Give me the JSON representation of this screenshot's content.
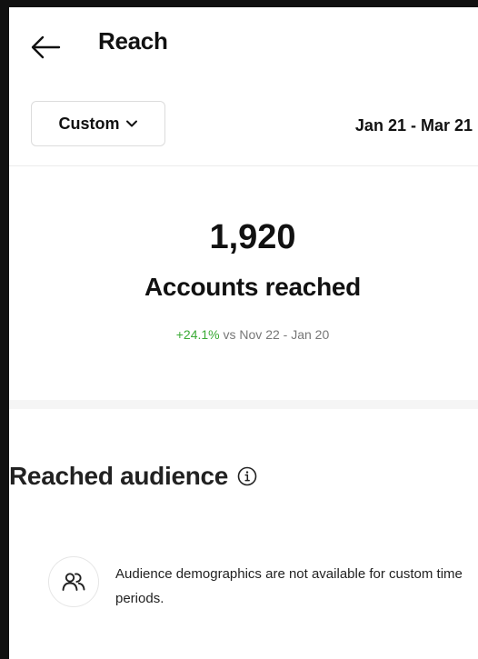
{
  "header": {
    "title": "Reach",
    "back_icon": "arrow-left-icon"
  },
  "filter": {
    "selected": "Custom",
    "chevron_icon": "chevron-down-icon",
    "date_range": "Jan 21 - Mar 21"
  },
  "summary": {
    "value": "1,920",
    "label": "Accounts reached",
    "change": "+24.1%",
    "comparison": "vs Nov 22 - Jan 20",
    "change_color": "#3aaa35"
  },
  "audience": {
    "title": "Reached audience",
    "info_icon": "info-icon",
    "notice_icon": "people-icon",
    "notice_text": "Audience demographics are not available for custom time periods."
  }
}
